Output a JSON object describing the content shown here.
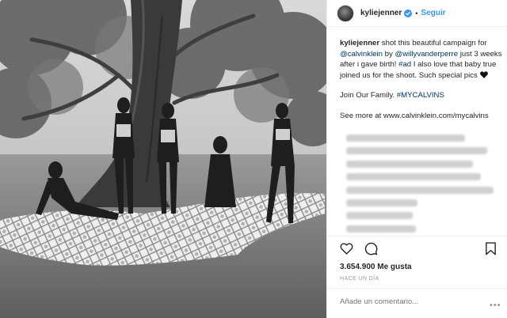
{
  "header": {
    "username": "kyliejenner",
    "separator": "•",
    "follow_label": "Seguir",
    "accent_color": "#3897f0"
  },
  "caption": {
    "author": "kyliejenner",
    "part1": " shot this beautiful campaign for ",
    "mention1": "@calvinklein",
    "part2": " by ",
    "mention2": "@willyvanderperre",
    "part3": " just 3 weeks after i gave birth! ",
    "hashtag1": "#ad",
    "part4": " I also love that baby true joined us for the shoot. Such special pics ",
    "join_text": "Join Our Family. ",
    "hashtag2": "#MYCALVINS",
    "see_more": "See more at www.calvinklein.com/mycalvins"
  },
  "comments_blurred_count": 8,
  "likes": "3.654.900 Me gusta",
  "timestamp": "HACE UN DÍA",
  "comment_placeholder": "Añade un comentario...",
  "more_label": "•••",
  "icons": {
    "verified": "verified-badge-icon",
    "heart": "heart-icon",
    "comment": "comment-icon",
    "save": "bookmark-icon",
    "black_heart": "black-heart-emoji"
  }
}
